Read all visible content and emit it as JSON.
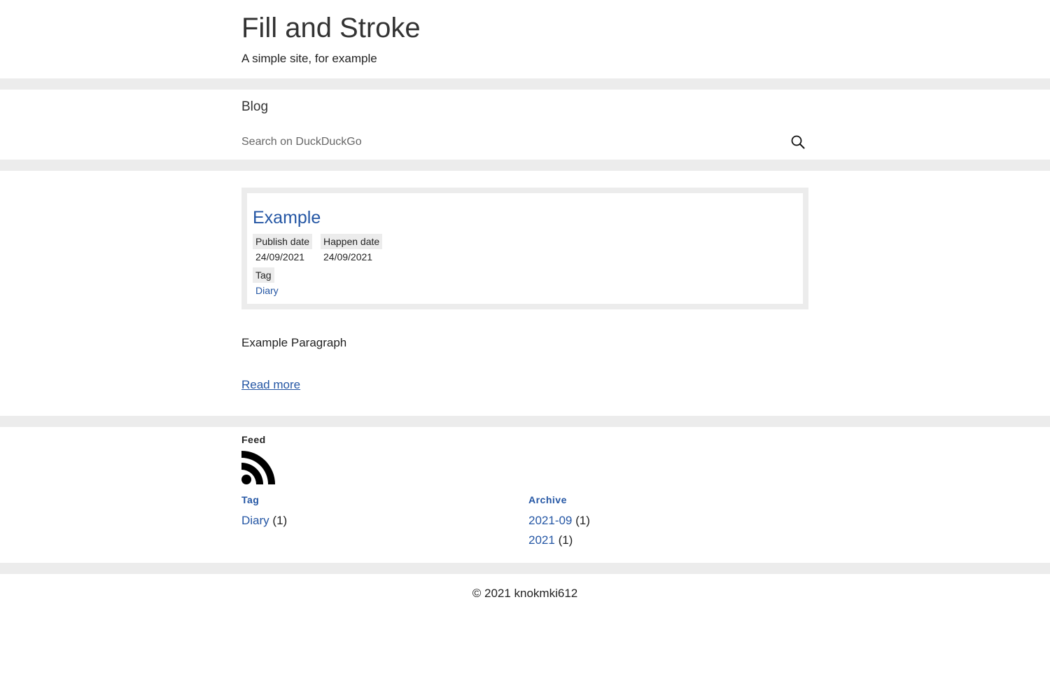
{
  "header": {
    "title": "Fill and Stroke",
    "subtitle": "A simple site, for example"
  },
  "nav": {
    "blog_label": "Blog",
    "search_placeholder": "Search on DuckDuckGo",
    "search_value": "",
    "search_icon": "search-icon"
  },
  "post": {
    "title": "Example",
    "publish_label": "Publish date",
    "publish_value": "24/09/2021",
    "happen_label": "Happen date",
    "happen_value": "24/09/2021",
    "tag_label": "Tag",
    "tag_value": "Diary",
    "paragraph": "Example Paragraph",
    "read_more": "Read more"
  },
  "widgets": {
    "feed_title": "Feed",
    "feed_icon": "rss-icon",
    "tag_title": "Tag",
    "tags": [
      {
        "name": "Diary",
        "count": "(1)"
      }
    ],
    "archive_title": "Archive",
    "archives": [
      {
        "name": "2021-09",
        "count": "(1)"
      },
      {
        "name": "2021",
        "count": "(1)"
      }
    ]
  },
  "footer": {
    "copyright": "© 2021 knokmki612"
  },
  "colors": {
    "link": "#2456a4",
    "band": "#ececec",
    "text": "#222222"
  }
}
